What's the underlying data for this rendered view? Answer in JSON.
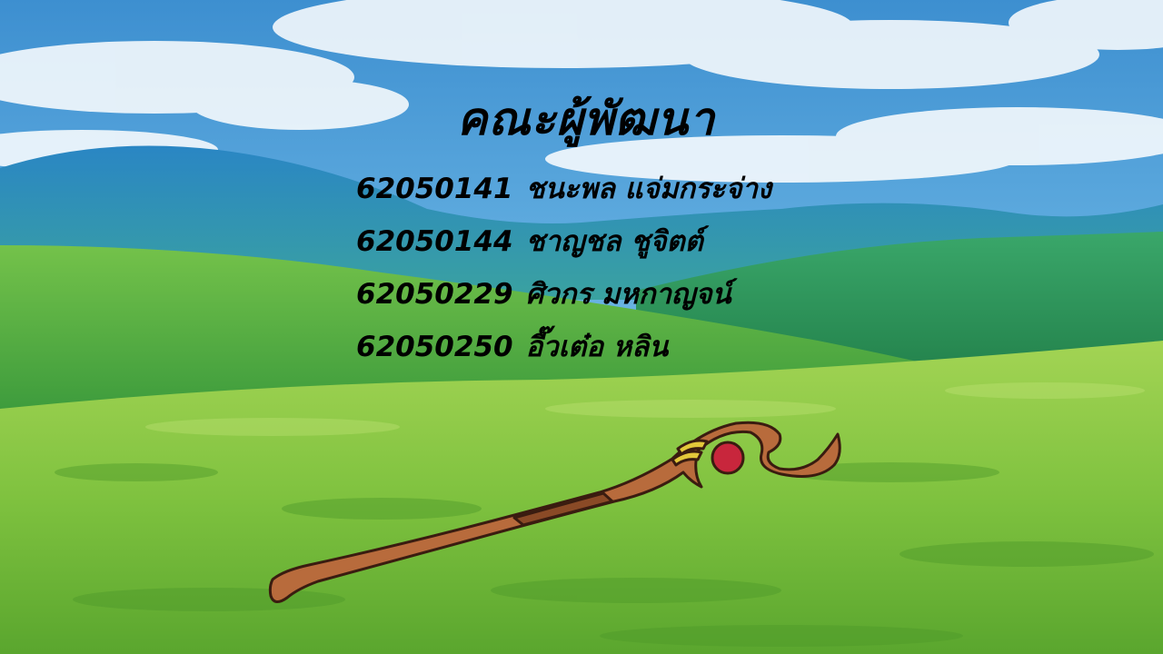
{
  "credits_screen": {
    "title": "คณะผู้พัฒนา",
    "members": [
      {
        "id": "62050141",
        "name": "ชนะพล แจ่มกระจ่าง"
      },
      {
        "id": "62050144",
        "name": "ชาญชล ชูจิตต์"
      },
      {
        "id": "62050229",
        "name": "ศิวกร มหกาญจน์"
      },
      {
        "id": "62050250",
        "name": "อี๊วเต๋อ หลิน"
      }
    ]
  },
  "colors": {
    "sky": "#4f9ed6",
    "sky_light": "#a9d6f0",
    "mountain": "#2b7fb8",
    "far_hill": "#2f9a5c",
    "meadow": "#7cc23c",
    "meadow_light": "#a6d658",
    "staff_wood": "#b86b3c",
    "staff_outline": "#3a1c10",
    "staff_band": "#e3c73a",
    "staff_gem": "#c8263c",
    "text": "#000000"
  },
  "icons": [
    "wooden-staff-icon"
  ]
}
